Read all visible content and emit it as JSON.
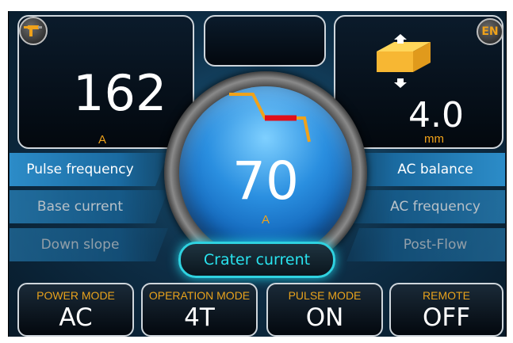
{
  "left_panel": {
    "value": "162",
    "unit": "A",
    "icon": "welding-torch-icon"
  },
  "right_panel": {
    "value": "4.0",
    "unit": "mm",
    "icon": "material-thickness-icon"
  },
  "language_button": {
    "label": "EN"
  },
  "knob": {
    "value": "70",
    "unit": "A",
    "icon": "current-graph-icon"
  },
  "left_params": [
    {
      "label": "Pulse frequency"
    },
    {
      "label": "Base current"
    },
    {
      "label": "Down slope"
    }
  ],
  "right_params": [
    {
      "label": "AC balance"
    },
    {
      "label": "AC frequency"
    },
    {
      "label": "Post-Flow"
    }
  ],
  "crater_button": {
    "label": "Crater current"
  },
  "bottom_buttons": [
    {
      "title": "POWER MODE",
      "value": "AC"
    },
    {
      "title": "OPERATION MODE",
      "value": "4T"
    },
    {
      "title": "PULSE MODE",
      "value": "ON"
    },
    {
      "title": "REMOTE",
      "value": "OFF"
    }
  ],
  "colors": {
    "accent": "#f0a21a",
    "highlight": "#29e3ef",
    "graph_active": "#e0101a",
    "panel_border": "#cfd6dc"
  }
}
